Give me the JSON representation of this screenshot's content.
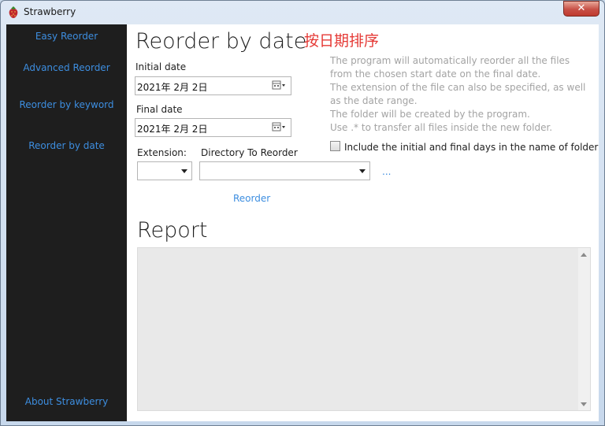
{
  "window": {
    "title": "Strawberry",
    "close_label": "✕"
  },
  "sidebar": {
    "items": [
      {
        "label": "Easy Reorder"
      },
      {
        "label": "Advanced Reorder"
      },
      {
        "label": "Reorder by keyword"
      },
      {
        "label": "Reorder by date"
      }
    ],
    "about_label": "About Strawberry"
  },
  "main": {
    "title": "Reorder by date",
    "annotation": "按日期排序",
    "initial_date_label": "Initial date",
    "initial_date_value": "2021年  2月  2日",
    "final_date_label": "Final date",
    "final_date_value": "2021年  2月  2日",
    "info_lines": [
      "The program will automatically reorder all the files",
      "from the chosen start date on the final date.",
      "The extension of the file can also be specified, as well",
      "as the date range.",
      "The folder will be created by the program.",
      " Use .* to transfer all files inside the new folder."
    ],
    "include_days_label": "Include the initial and final days in the name of folder",
    "extension_label": "Extension:",
    "directory_label": "Directory To Reorder",
    "extension_value": "",
    "directory_value": "",
    "browse_label": "...",
    "reorder_label": "Reorder",
    "report_title": "Report"
  },
  "icons": {
    "app": "strawberry-icon",
    "calendar": "calendar-icon"
  },
  "colors": {
    "sidebar_bg": "#1e1e1e",
    "link": "#3d8ee0",
    "annotation": "#e53935",
    "info_text": "#a3a3a3"
  }
}
